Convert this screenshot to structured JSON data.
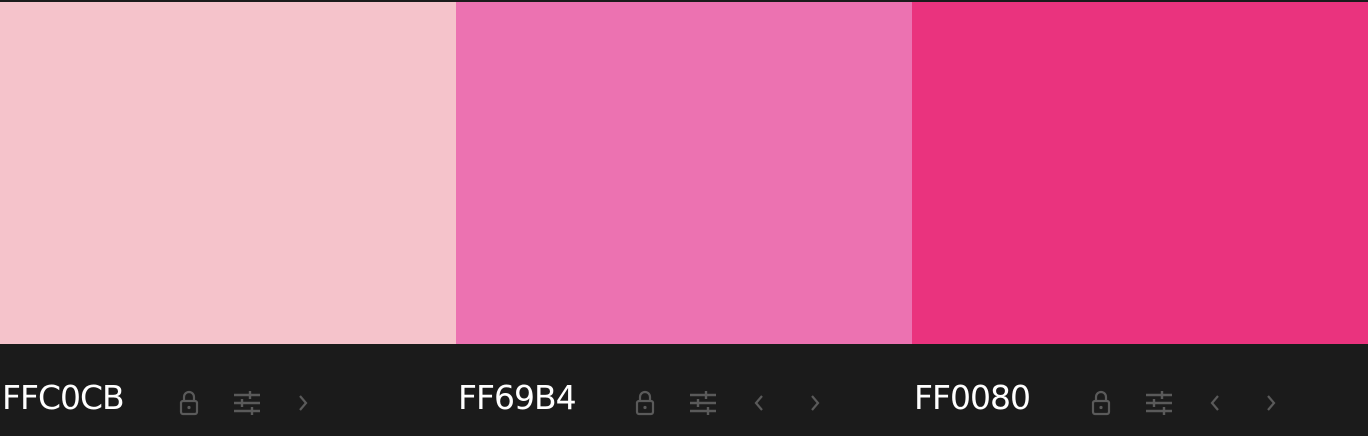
{
  "palette": {
    "colors": [
      {
        "hex": "FFC0CB",
        "swatch_color": "#F5C3CB",
        "has_prev": false,
        "has_next": true
      },
      {
        "hex": "FF69B4",
        "swatch_color": "#EC72B1",
        "has_prev": true,
        "has_next": true
      },
      {
        "hex": "FF0080",
        "swatch_color": "#EA337E",
        "has_prev": true,
        "has_next": true
      }
    ],
    "icons": {
      "lock": "lock-icon",
      "adjust": "sliders-icon",
      "prev": "chevron-left-icon",
      "next": "chevron-right-icon"
    },
    "icon_color": "#5a5a5a",
    "bar_color": "#1b1b1b",
    "text_color": "#ffffff"
  }
}
